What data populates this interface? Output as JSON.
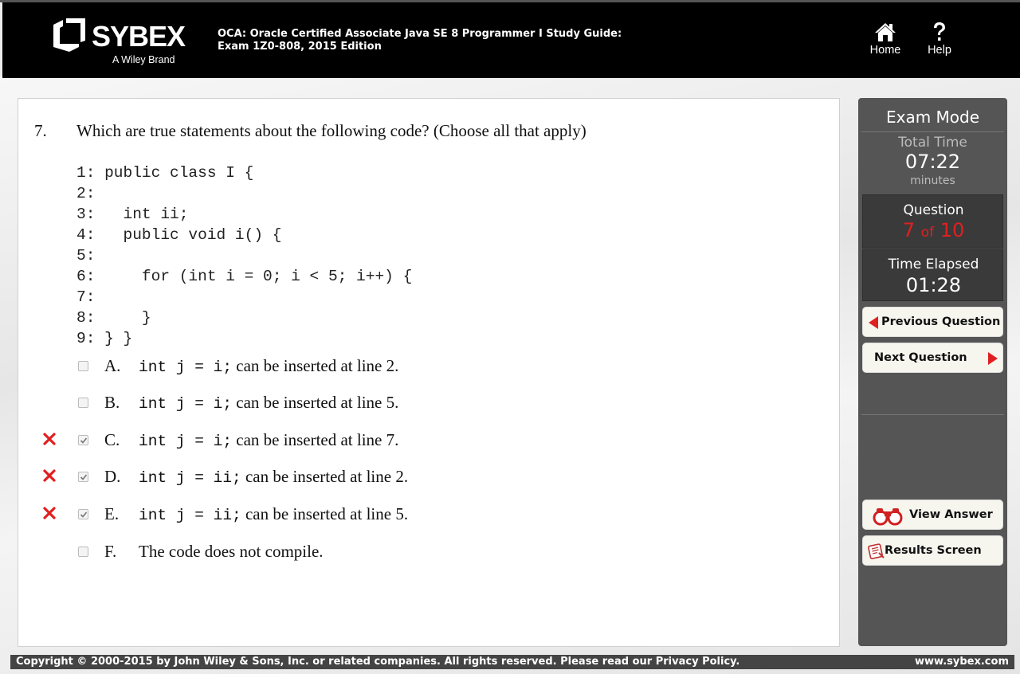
{
  "header": {
    "logo_text": "SYBEX",
    "logo_subtitle": "A Wiley Brand",
    "book_title_line1": "OCA: Oracle Certified Associate Java SE 8 Programmer I Study Guide:",
    "book_title_line2": "Exam 1Z0-808, 2015 Edition",
    "nav": [
      {
        "label": "Home",
        "icon": "home-icon"
      },
      {
        "label": "Help",
        "icon": "help-icon"
      }
    ]
  },
  "question": {
    "number": "7.",
    "text": "Which are true statements about the following code? (Choose all that apply)",
    "code_lines": [
      "1: public class I {",
      "2:",
      "3:   int ii;",
      "4:   public void i() {",
      "5:",
      "6:     for (int i = 0; i < 5; i++) {",
      "7:",
      "8:     }",
      "9: } }"
    ],
    "answers": [
      {
        "letter": "A.",
        "code": "int j = i;",
        "text": " can be inserted at line 2.",
        "checked": false,
        "marked_wrong": false
      },
      {
        "letter": "B.",
        "code": "int j = i;",
        "text": " can be inserted at line 5.",
        "checked": false,
        "marked_wrong": false
      },
      {
        "letter": "C.",
        "code": "int j = i;",
        "text": " can be inserted at line 7.",
        "checked": true,
        "marked_wrong": true
      },
      {
        "letter": "D.",
        "code": "int j = ii;",
        "text": " can be inserted at line 2.",
        "checked": true,
        "marked_wrong": true
      },
      {
        "letter": "E.",
        "code": "int j = ii;",
        "text": " can be inserted at line 5.",
        "checked": true,
        "marked_wrong": true
      },
      {
        "letter": "F.",
        "code": "",
        "text": "The code does not compile.",
        "checked": false,
        "marked_wrong": false
      }
    ]
  },
  "sidebar": {
    "mode_title": "Exam Mode",
    "total_time_label": "Total Time",
    "total_time_value": "07:22",
    "total_time_unit": "minutes",
    "question_label": "Question",
    "question_current": "7",
    "question_of": "of",
    "question_total": "10",
    "elapsed_label": "Time Elapsed",
    "elapsed_value": "01:28",
    "prev_label": "Previous Question",
    "next_label": "Next Question",
    "view_answer_label": "View Answer",
    "results_label": "Results Screen"
  },
  "footer": {
    "copyright": "Copyright © 2000-2015 by John Wiley & Sons, Inc. or related companies. All rights reserved. Please read our Privacy Policy.",
    "site": "www.sybex.com"
  },
  "colors": {
    "accent_red": "#e02020",
    "header_bg": "#000000",
    "sidebar_bg": "#555555"
  }
}
